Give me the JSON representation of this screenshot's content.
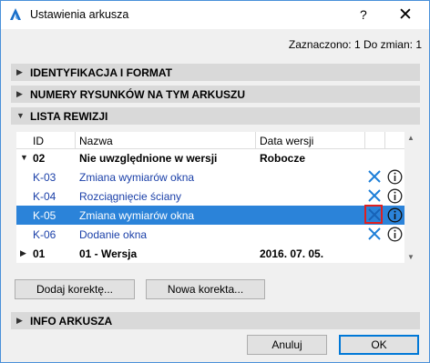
{
  "window": {
    "title": "Ustawienia arkusza",
    "help": "?",
    "close": "✕"
  },
  "status_text": "Zaznaczono: 1 Do zmian: 1",
  "sections": {
    "identification": "IDENTYFIKACJA I FORMAT",
    "drawing_numbers": "NUMERY RYSUNKÓW NA TYM ARKUSZU",
    "revision_list": "LISTA REWIZJI",
    "sheet_info": "INFO ARKUSZA"
  },
  "table": {
    "columns": [
      "ID",
      "Nazwa",
      "Data wersji"
    ],
    "rows": [
      {
        "id": "02",
        "name": "Nie uwzględnione w wersji",
        "date": "Robocze"
      },
      {
        "id": "K-03",
        "name": "Zmiana wymiarów okna",
        "date": ""
      },
      {
        "id": "K-04",
        "name": "Rozciągnięcie ściany",
        "date": ""
      },
      {
        "id": "K-05",
        "name": "Zmiana wymiarów okna",
        "date": ""
      },
      {
        "id": "K-06",
        "name": "Dodanie okna",
        "date": ""
      },
      {
        "id": "01",
        "name": "01 - Wersja",
        "date": "2016. 07. 05."
      }
    ]
  },
  "buttons": {
    "add_correction": "Dodaj korektę...",
    "new_correction": "Nowa korekta...",
    "cancel": "Anuluj",
    "ok": "OK"
  },
  "colors": {
    "selection": "#2b83d9",
    "link": "#1a3fa8",
    "highlight_box": "#e02020",
    "x_icon": "#1e7fd8"
  },
  "icons": {
    "row_action": "x-icon",
    "row_info": "info-icon"
  }
}
